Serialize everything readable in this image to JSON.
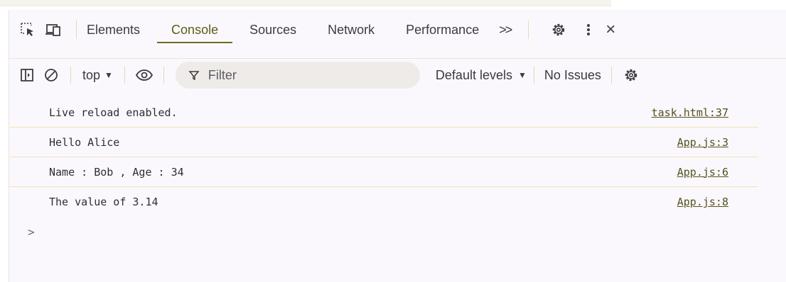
{
  "tabs": [
    "Elements",
    "Console",
    "Sources",
    "Network",
    "Performance"
  ],
  "more_tabs_label": ">>",
  "close_label": "×",
  "toolbar": {
    "context": "top",
    "filter_placeholder": "Filter",
    "levels": "Default levels",
    "issues": "No Issues"
  },
  "console": {
    "messages": [
      {
        "text": "Live reload enabled.",
        "source": "task.html:37"
      },
      {
        "text": "Hello Alice",
        "source": "App.js:3"
      },
      {
        "text": "Name : Bob , Age : 34",
        "source": "App.js:6"
      },
      {
        "text": "The value of 3.14",
        "source": "App.js:8"
      }
    ],
    "prompt": ">"
  },
  "icons": {
    "inspect": "inspect-element-icon",
    "device": "device-toolbar-icon",
    "sidebar": "sidebar-toggle-icon",
    "clear": "clear-console-icon",
    "eye": "live-expression-eye-icon",
    "filter": "filter-icon",
    "settings": "gear-icon",
    "more": "kebab-menu-icon"
  },
  "colors": {
    "accent": "#6f6a1f",
    "panel_bg": "#fbf8fd",
    "row_border": "#f0e3b4",
    "link": "#54501f"
  }
}
